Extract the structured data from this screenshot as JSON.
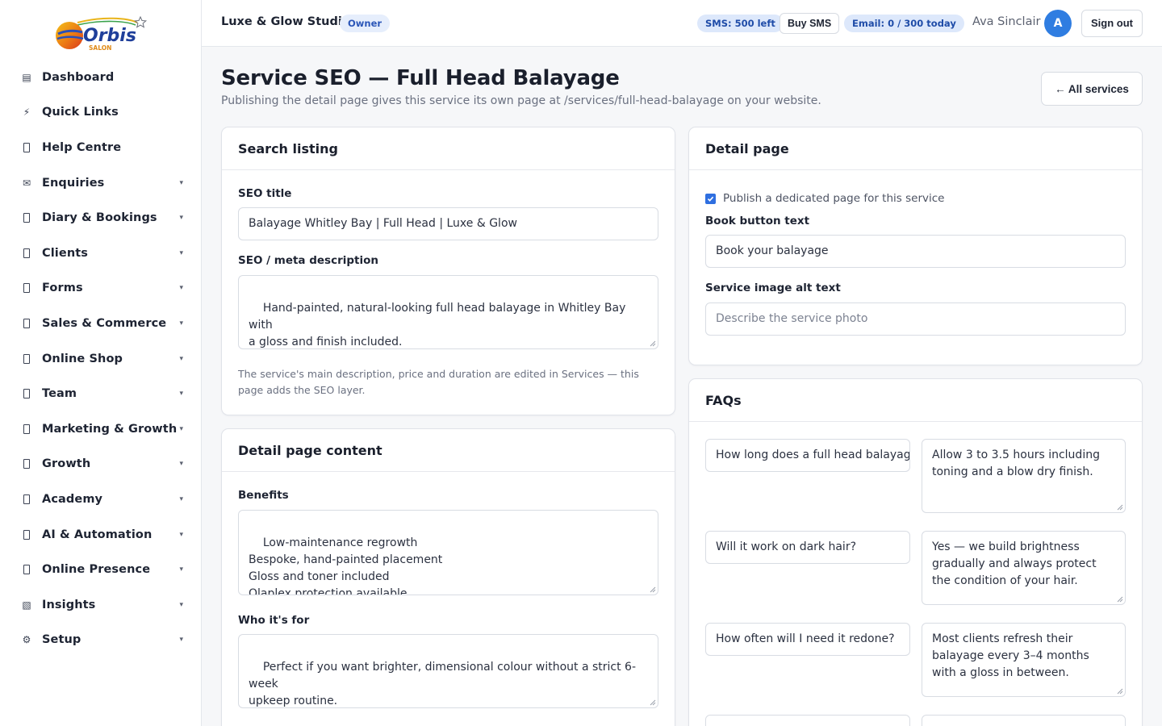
{
  "sidebar": {
    "logo_text": "Orbis",
    "logo_subtext": "SALON",
    "items": [
      {
        "label": "Dashboard",
        "icon": "dashboard-icon",
        "glyph": "▤",
        "caret": false
      },
      {
        "label": "Quick Links",
        "icon": "bolt-icon",
        "glyph": "⚡",
        "caret": false
      },
      {
        "label": "Help Centre",
        "icon": "help-icon",
        "glyph": "",
        "caret": false
      },
      {
        "label": "Enquiries",
        "icon": "mail-icon",
        "glyph": "✉",
        "caret": true
      },
      {
        "label": "Diary & Bookings",
        "icon": "calendar-icon",
        "glyph": "",
        "caret": true
      },
      {
        "label": "Clients",
        "icon": "clients-icon",
        "glyph": "",
        "caret": true
      },
      {
        "label": "Forms",
        "icon": "forms-icon",
        "glyph": "",
        "caret": true
      },
      {
        "label": "Sales & Commerce",
        "icon": "sales-icon",
        "glyph": "",
        "caret": true
      },
      {
        "label": "Online Shop",
        "icon": "shop-icon",
        "glyph": "",
        "caret": true
      },
      {
        "label": "Team",
        "icon": "team-icon",
        "glyph": "",
        "caret": true
      },
      {
        "label": "Marketing & Growth",
        "icon": "marketing-icon",
        "glyph": "",
        "caret": true
      },
      {
        "label": "Growth",
        "icon": "growth-icon",
        "glyph": "",
        "caret": true
      },
      {
        "label": "Academy",
        "icon": "academy-icon",
        "glyph": "",
        "caret": true
      },
      {
        "label": "AI & Automation",
        "icon": "ai-icon",
        "glyph": "",
        "caret": true
      },
      {
        "label": "Online Presence",
        "icon": "globe-icon",
        "glyph": "",
        "caret": true
      },
      {
        "label": "Insights",
        "icon": "insights-icon",
        "glyph": "▧",
        "caret": true
      },
      {
        "label": "Setup",
        "icon": "gear-icon",
        "glyph": "⚙",
        "caret": true
      }
    ],
    "caret_glyph": "▾"
  },
  "topbar": {
    "studio_name": "Luxe & Glow Studio",
    "role_badge": "Owner",
    "sms_badge": "SMS: 500 left",
    "buy_sms": "Buy SMS",
    "email_badge": "Email: 0 / 300 today",
    "user_name": "Ava Sinclair",
    "avatar_initial": "A",
    "sign_out": "Sign out"
  },
  "page": {
    "title": "Service SEO — Full Head Balayage",
    "subtitle": "Publishing the detail page gives this service its own page at /services/full-head-balayage on your website.",
    "back_button": "← All services"
  },
  "search_listing": {
    "heading": "Search listing",
    "seo_title_label": "SEO title",
    "seo_title_value": "Balayage Whitley Bay | Full Head | Luxe & Glow",
    "meta_label": "SEO / meta description",
    "meta_value": "Hand-painted, natural-looking full head balayage in Whitley Bay with\na gloss and finish included.",
    "help_text_1": "The service's main description, price and duration are edited in Services — this",
    "help_text_2": "page adds the SEO layer."
  },
  "detail_content": {
    "heading": "Detail page content",
    "benefits_label": "Benefits",
    "benefits_value": "Low-maintenance regrowth\nBespoke, hand-painted placement\nGloss and toner included\nOlaplex protection available",
    "who_label": "Who it's for",
    "who_value": "Perfect if you want brighter, dimensional colour without a strict 6-week\nupkeep routine."
  },
  "detail_page": {
    "heading": "Detail page",
    "publish_label": "Publish a dedicated page for this service",
    "publish_checked": true,
    "book_label": "Book button text",
    "book_value": "Book your balayage",
    "alt_label": "Service image alt text",
    "alt_placeholder": "Describe the service photo"
  },
  "faqs": {
    "heading": "FAQs",
    "items": [
      {
        "question": "How long does a full head balayage take?",
        "answer": "Allow 3 to 3.5 hours including\ntoning and a blow dry finish."
      },
      {
        "question": "Will it work on dark hair?",
        "answer": "Yes — we build brightness\ngradually and always protect\nthe condition of your hair."
      },
      {
        "question": "How often will I need it redone?",
        "answer": "Most clients refresh their\nbalayage every 3–4 months\nwith a gloss in between."
      }
    ]
  },
  "colors": {
    "accent": "#2f6fe0",
    "badge_bg": "#dde8fb",
    "avatar": "#2f7de1"
  }
}
